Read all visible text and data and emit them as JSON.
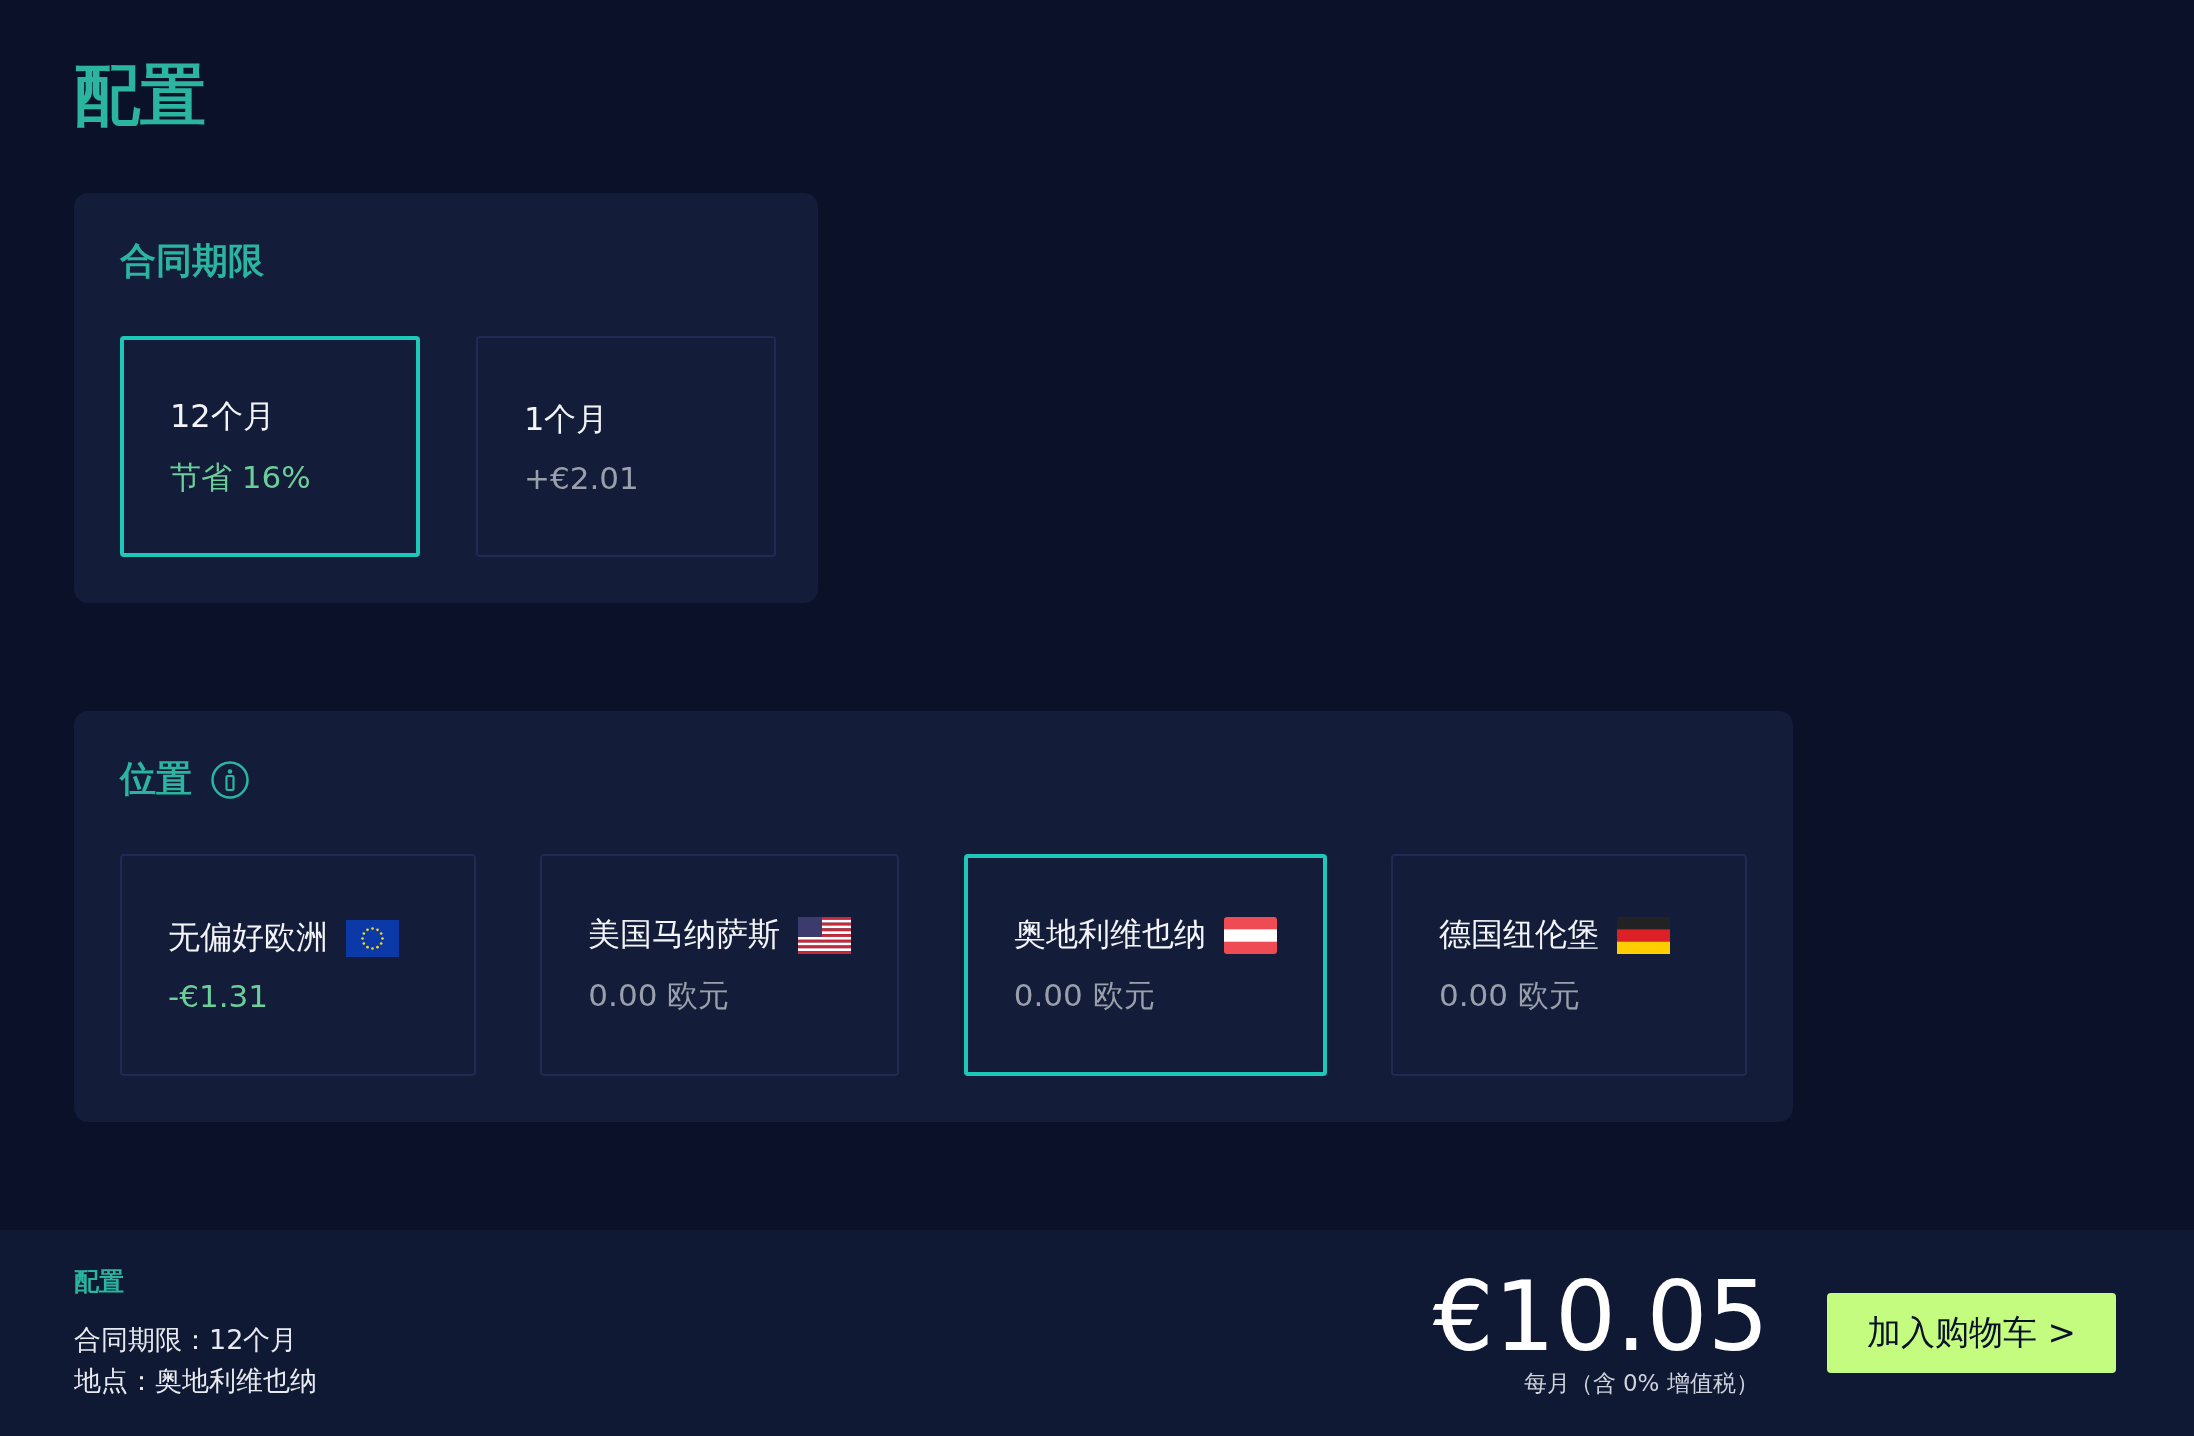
{
  "title": "配置",
  "contract": {
    "heading": "合同期限",
    "options": [
      {
        "label": "12个月",
        "note": "节省 16%",
        "saving": true,
        "selected": true
      },
      {
        "label": "1个月",
        "note": "+€2.01",
        "saving": false,
        "selected": false
      }
    ]
  },
  "location": {
    "heading": "位置",
    "options": [
      {
        "label": "无偏好欧洲",
        "kind": "eu",
        "note": "-€1.31",
        "saving": true,
        "selected": false
      },
      {
        "label": "美国马纳萨斯",
        "kind": "us",
        "note": "0.00 欧元",
        "saving": false,
        "selected": false
      },
      {
        "label": "奥地利维也纳",
        "kind": "at",
        "note": "0.00 欧元",
        "saving": false,
        "selected": true
      },
      {
        "label": "德国纽伦堡",
        "kind": "de",
        "note": "0.00 欧元",
        "saving": false,
        "selected": false
      }
    ]
  },
  "summary": {
    "heading": "配置",
    "lines": [
      "合同期限：12个月",
      "地点：奥地利维也纳"
    ],
    "price": "€10.05",
    "price_note": "每月（含 0% 增值税）",
    "button": "加入购物车 >"
  }
}
